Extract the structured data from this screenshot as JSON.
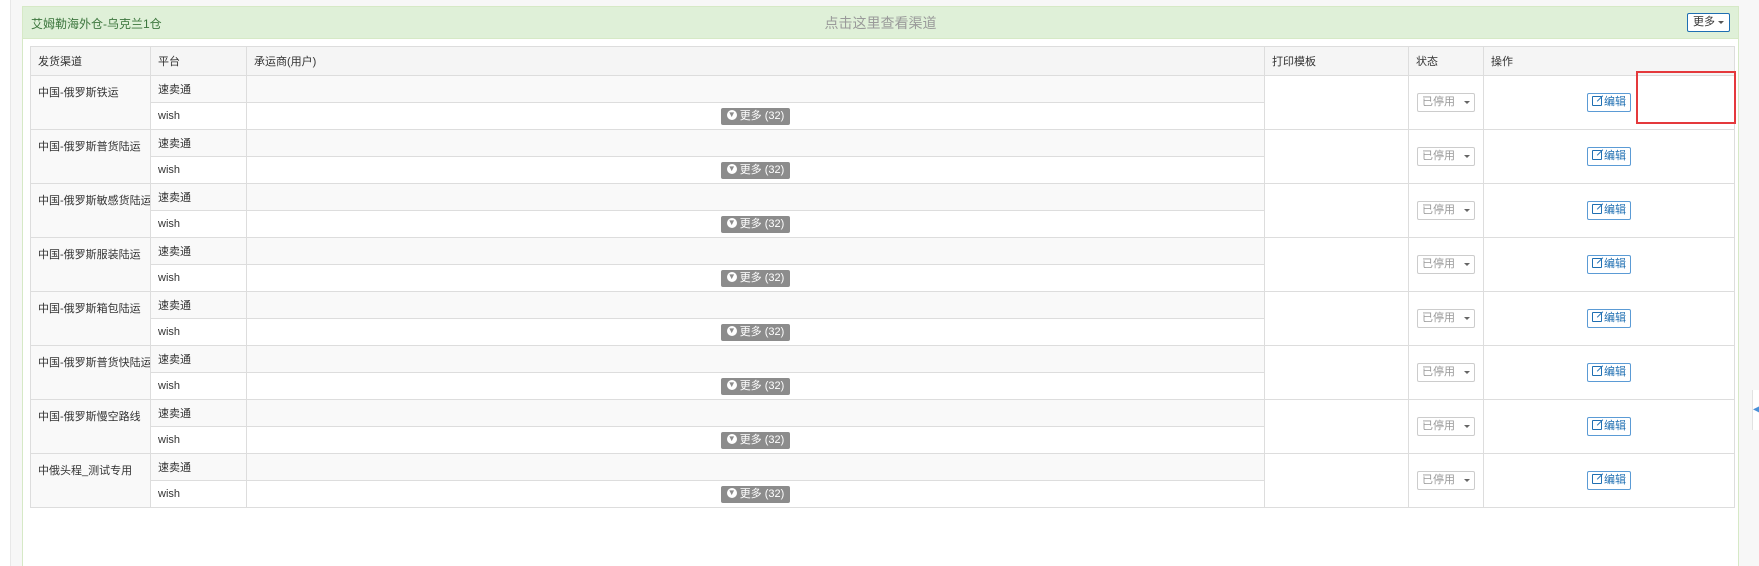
{
  "panel": {
    "title": "艾姆勒海外仓-乌克兰1仓",
    "center_link": "点击这里查看渠道",
    "more_button": "更多"
  },
  "table": {
    "headers": {
      "channel": "发货渠道",
      "platform": "平台",
      "carrier": "承运商(用户)",
      "template": "打印模板",
      "status": "状态",
      "action": "操作"
    },
    "rows": [
      {
        "name": "中国-俄罗斯铁运",
        "platform1": "速卖通",
        "platform2": "wish",
        "more": "更多 (32)",
        "status": "已停用",
        "edit": "编辑"
      },
      {
        "name": "中国-俄罗斯普货陆运",
        "platform1": "速卖通",
        "platform2": "wish",
        "more": "更多 (32)",
        "status": "已停用",
        "edit": "编辑"
      },
      {
        "name": "中国-俄罗斯敏感货陆运",
        "platform1": "速卖通",
        "platform2": "wish",
        "more": "更多 (32)",
        "status": "已停用",
        "edit": "编辑"
      },
      {
        "name": "中国-俄罗斯服装陆运",
        "platform1": "速卖通",
        "platform2": "wish",
        "more": "更多 (32)",
        "status": "已停用",
        "edit": "编辑"
      },
      {
        "name": "中国-俄罗斯箱包陆运",
        "platform1": "速卖通",
        "platform2": "wish",
        "more": "更多 (32)",
        "status": "已停用",
        "edit": "编辑"
      },
      {
        "name": "中国-俄罗斯普货快陆运",
        "platform1": "速卖通",
        "platform2": "wish",
        "more": "更多 (32)",
        "status": "已停用",
        "edit": "编辑"
      },
      {
        "name": "中国-俄罗斯慢空路线",
        "platform1": "速卖通",
        "platform2": "wish",
        "more": "更多 (32)",
        "status": "已停用",
        "edit": "编辑"
      },
      {
        "name": "中俄头程_测试专用",
        "platform1": "速卖通",
        "platform2": "wish",
        "more": "更多 (32)",
        "status": "已停用",
        "edit": "编辑"
      }
    ]
  },
  "colors": {
    "panel_header_bg": "#dff0d8",
    "highlight": "#e4393c",
    "edit_button": "#1f6fb2"
  },
  "icons": {
    "more_expand": "circle-arrow-down-icon",
    "edit": "edit-icon",
    "status_dropdown": "caret-down-icon"
  }
}
